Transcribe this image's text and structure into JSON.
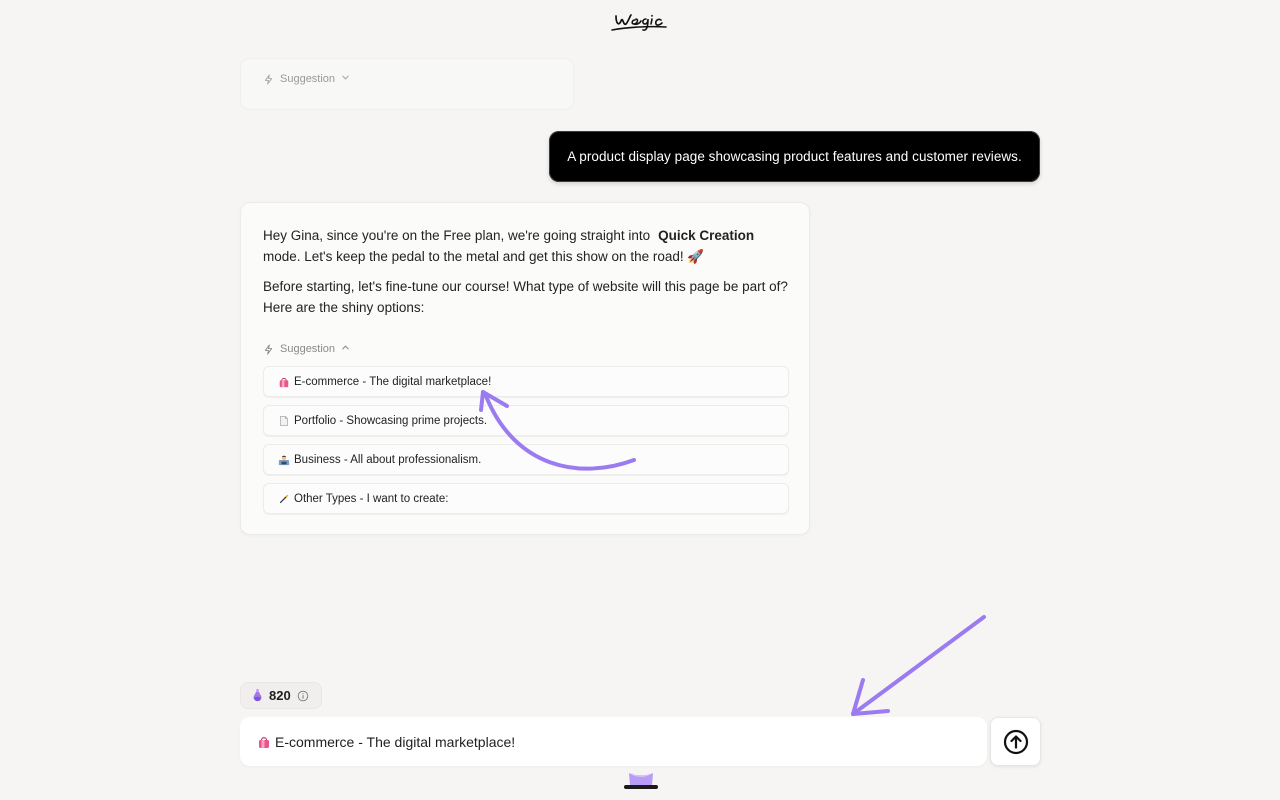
{
  "brand": {
    "logo_text": "wegic"
  },
  "top_card": {
    "suggestion_label": "Suggestion"
  },
  "user_message": "A product display page showcasing product features and customer reviews.",
  "assistant": {
    "p1_text": "Hey Gina, since you're on the Free plan, we're going straight into",
    "p1_strong": "Quick Creation",
    "p1_rest": "mode. Let's keep the pedal to the metal and get this show on the road! 🚀",
    "p2_text": "Before starting, let's fine-tune our course! What type of website will this page be part of? Here are the shiny options:",
    "suggestion_label": "Suggestion",
    "options": [
      {
        "label": "E-commerce - The digital marketplace!",
        "icon": "shopping-bag-icon"
      },
      {
        "label": "Portfolio - Showcasing prime projects.",
        "icon": "document-icon"
      },
      {
        "label": "Business - All about professionalism.",
        "icon": "office-worker-icon"
      },
      {
        "label": "Other Types - I want to create:",
        "icon": "magic-wand-icon"
      }
    ]
  },
  "credits": {
    "value": "820",
    "icon": "potion-icon"
  },
  "composer": {
    "value": "E-commerce - The digital marketplace!",
    "icon": "shopping-bag-icon",
    "send_icon": "arrow-up-circle-icon"
  },
  "colors": {
    "background": "#f6f5f3",
    "user_bubble": "#000000",
    "annotation_arrow": "#9b7cf0",
    "accent_purple": "#b89cf5"
  }
}
